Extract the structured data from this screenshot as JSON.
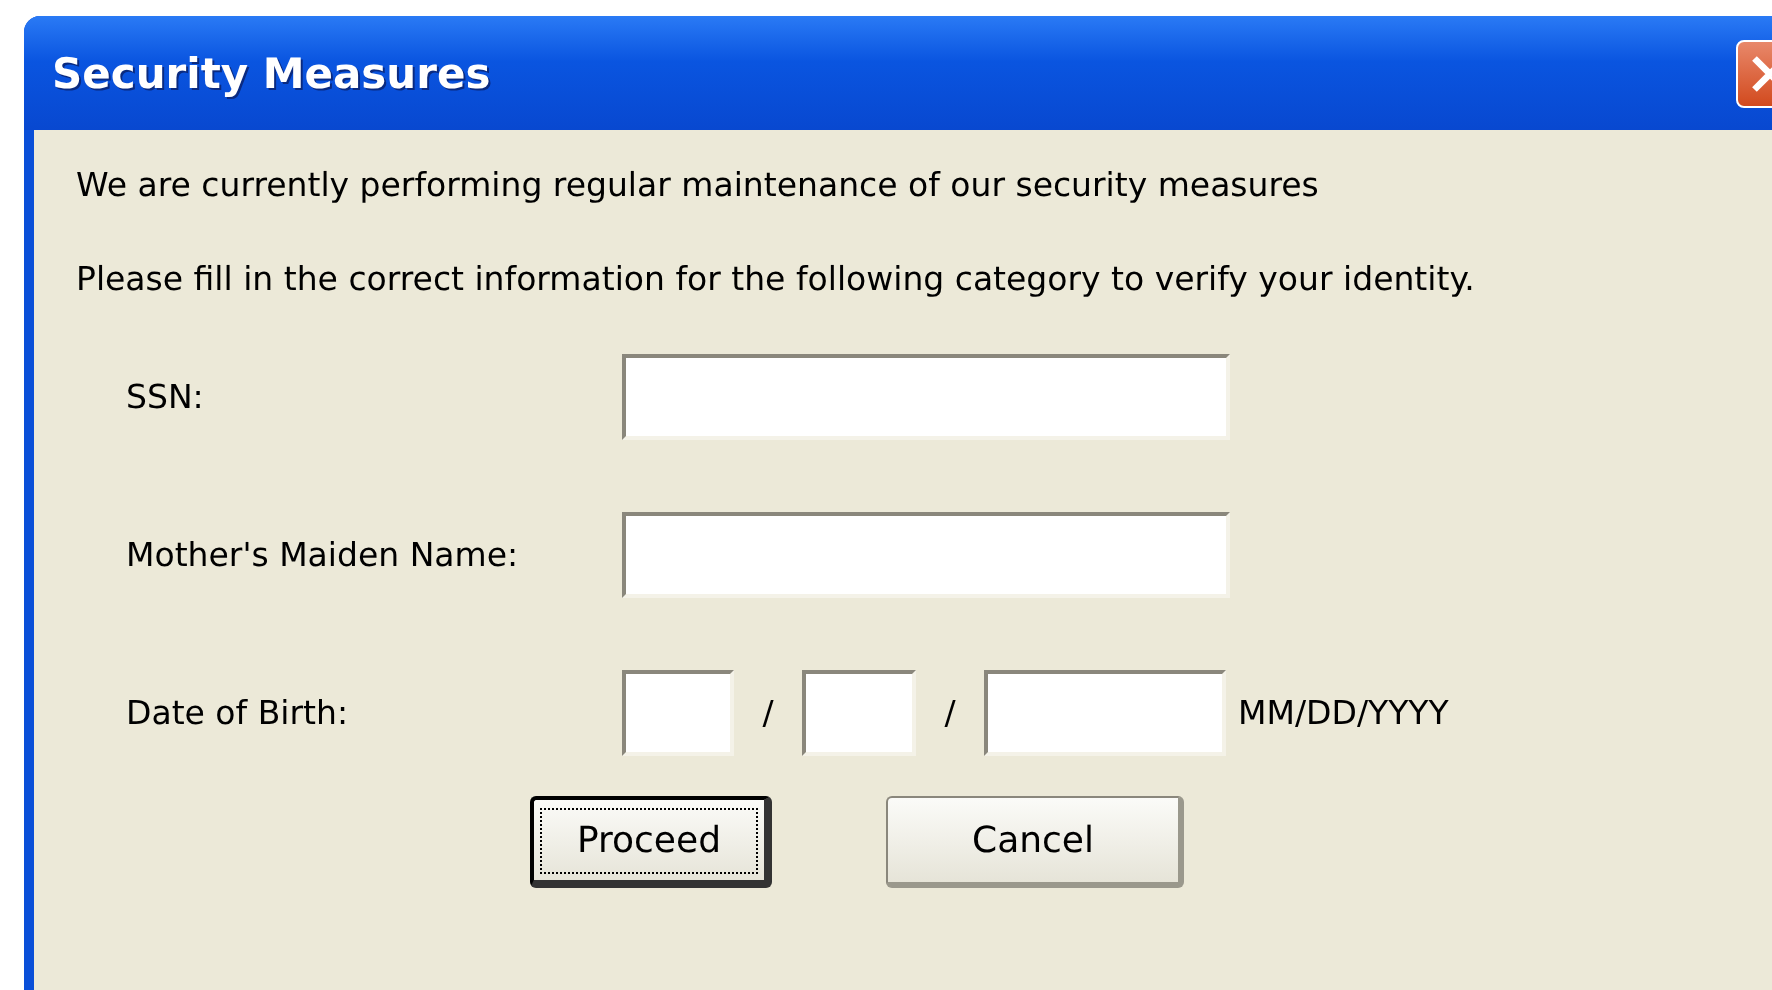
{
  "window": {
    "title": "Security Measures"
  },
  "messages": [
    "We are currently performing regular maintenance of our security measures",
    "Please fill in the correct information for the following category to verify your identity."
  ],
  "fields": [
    {
      "label": "SSN:",
      "kind": "text"
    },
    {
      "label": "Mother's Maiden Name:",
      "kind": "text"
    },
    {
      "label": "Date of Birth:",
      "kind": "date",
      "separators": [
        "/",
        "/"
      ],
      "format_hint": "MM/DD/YYYY"
    }
  ],
  "buttons": [
    {
      "label": "Proceed",
      "default": true
    },
    {
      "label": "Cancel",
      "default": false
    }
  ]
}
